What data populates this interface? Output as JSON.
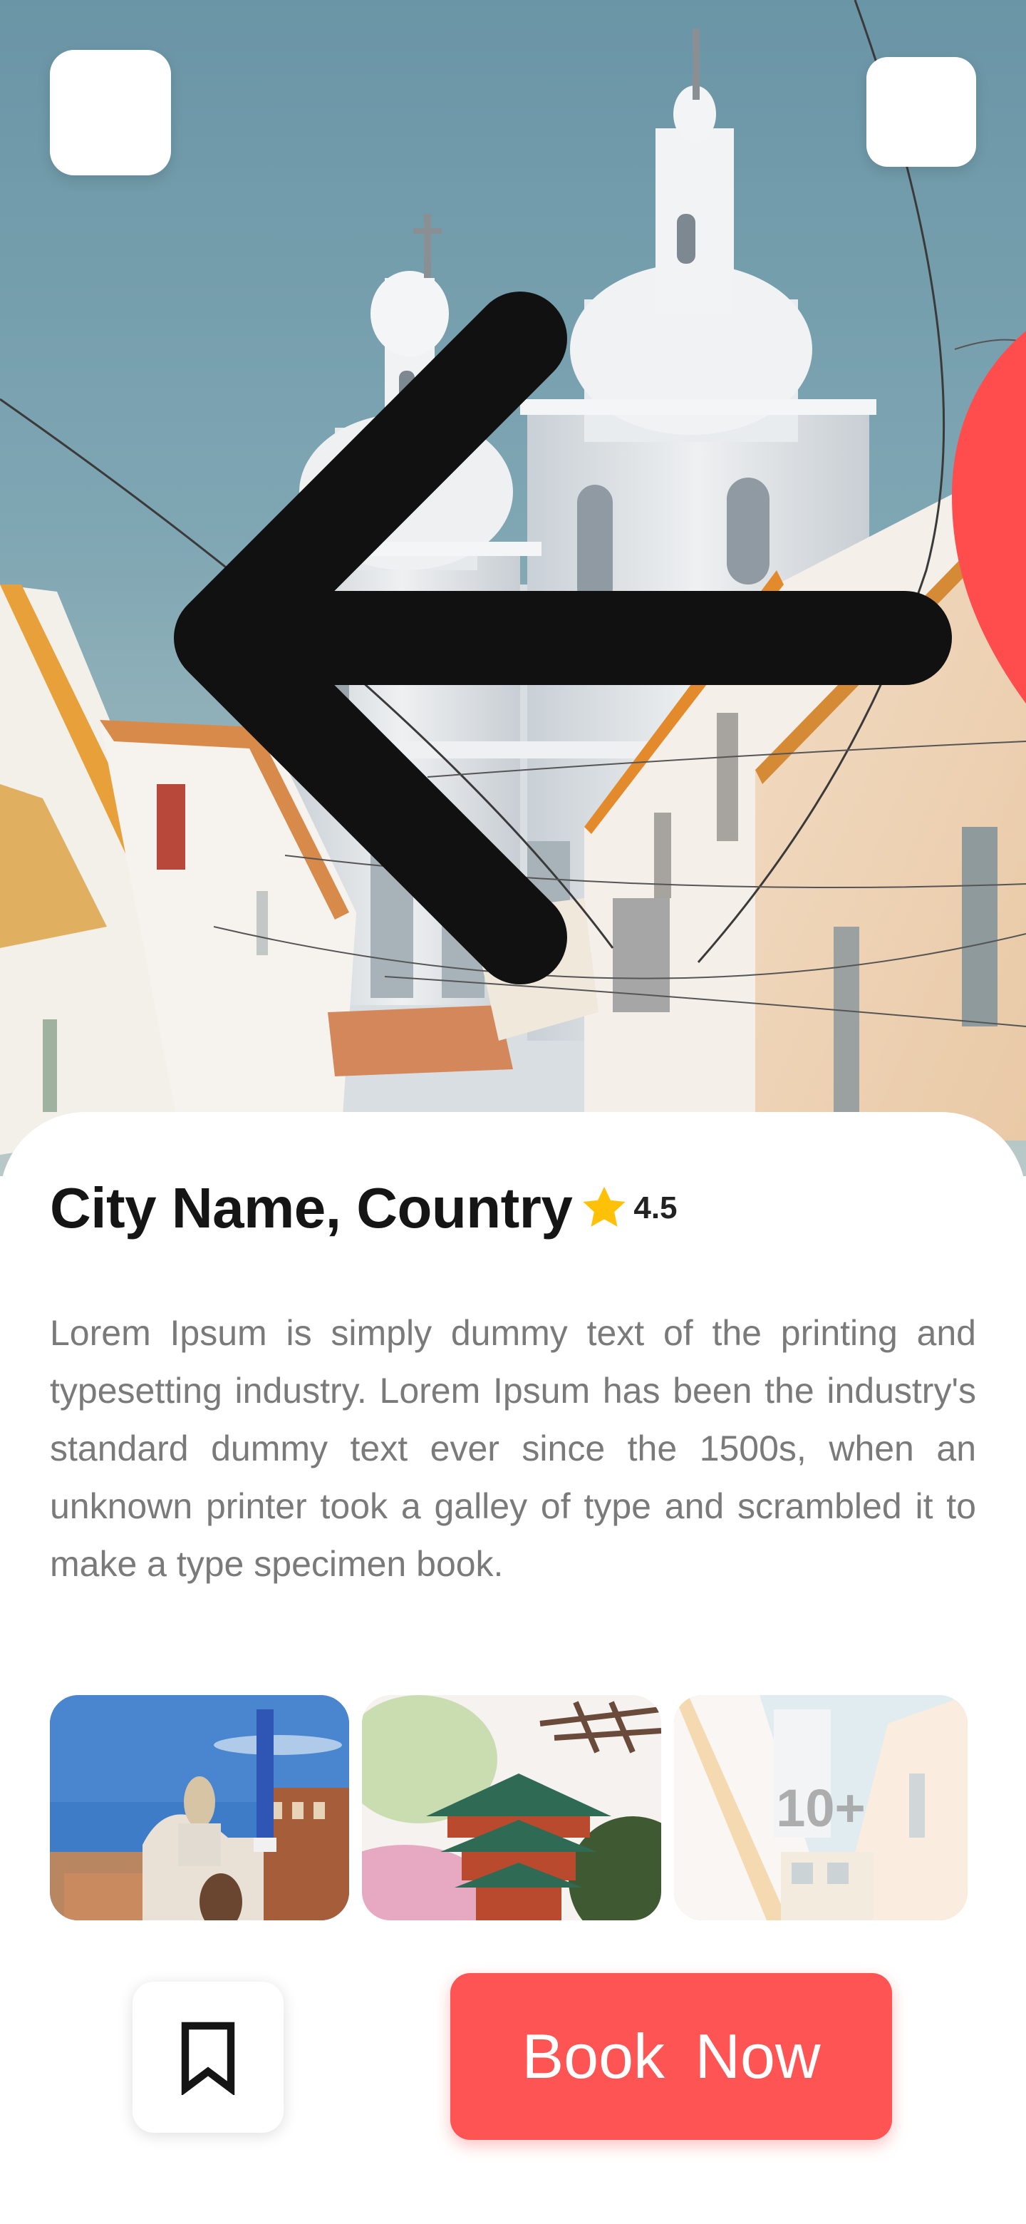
{
  "header": {
    "back_icon": "arrow-left-icon",
    "favorite_icon": "heart-icon",
    "favorite_color": "#ff4d4d"
  },
  "destination": {
    "title": "City Name, Country",
    "rating": "4.5",
    "rating_icon": "star-icon",
    "star_color": "#ffc107",
    "description": "Lorem Ipsum is simply dummy text of the printing and typesetting industry. Lorem Ipsum has been the industry's standard dummy text ever since the 1500s, when an unknown printer took a galley of type and scrambled it to make a type specimen book."
  },
  "gallery": {
    "more_label": "10+"
  },
  "actions": {
    "bookmark_icon": "bookmark-icon",
    "book_label": "Book  Now",
    "accent_color": "#ff5454"
  }
}
